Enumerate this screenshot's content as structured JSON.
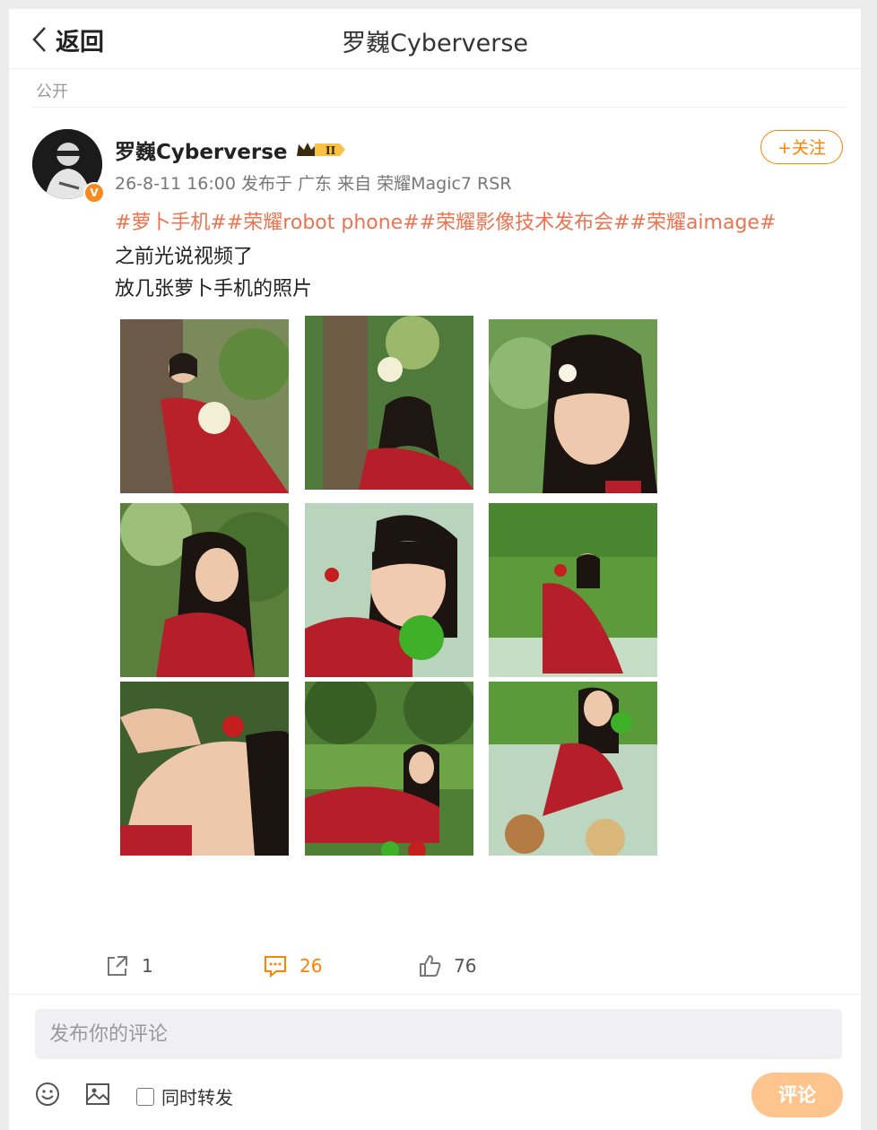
{
  "header": {
    "back_label": "返回",
    "title": "罗巍Cyberverse"
  },
  "post": {
    "visibility": "公开",
    "author": "罗巍Cyberverse",
    "meta": "26-8-11 16:00 发布于 广东 来自 荣耀Magic7 RSR",
    "hashtags": "#萝卜手机##荣耀robot phone##荣耀影像技术发布会##荣耀aimage#",
    "lines": [
      "之前光说视频了",
      "放几张萝卜手机的照片"
    ],
    "follow_label": "+关注",
    "verified_badge": "V",
    "level_badge": "II"
  },
  "actions": {
    "reposts": "1",
    "comments": "26",
    "likes": "76"
  },
  "comment_box": {
    "placeholder": "发布你的评论",
    "repost_label": "同时转发",
    "submit_label": "评论"
  },
  "colors": {
    "accent": "#ff8200",
    "hashtag": "#eb7350",
    "submit": "#fdc48d"
  },
  "icons": [
    "chevron-left-icon",
    "crown-badge-icon",
    "share-icon",
    "comment-icon",
    "like-icon",
    "emoji-icon",
    "image-icon"
  ]
}
